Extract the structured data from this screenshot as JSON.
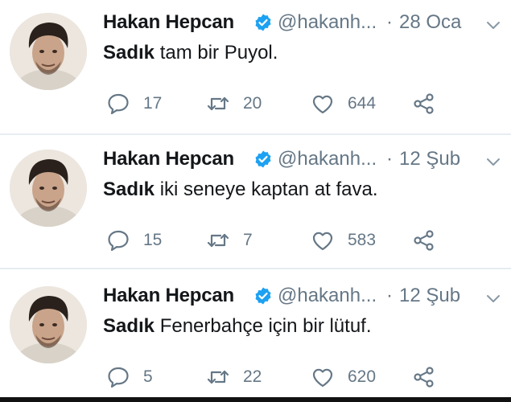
{
  "tweets": [
    {
      "author_name": "Hakan Hepcan",
      "handle": "@hakanh...",
      "separator": "·",
      "date": "28 Oca",
      "text_bold": "Sadık",
      "text_rest": " tam bir Puyol.",
      "replies": "17",
      "retweets": "20",
      "likes": "644"
    },
    {
      "author_name": "Hakan Hepcan",
      "handle": "@hakanh...",
      "separator": "·",
      "date": "12 Şub",
      "text_bold": "Sadık",
      "text_rest": " iki seneye kaptan at fava.",
      "replies": "15",
      "retweets": "7",
      "likes": "583"
    },
    {
      "author_name": "Hakan Hepcan",
      "handle": "@hakanh...",
      "separator": "·",
      "date": "12 Şub",
      "text_bold": "Sadık",
      "text_rest": " Fenerbahçe için bir lütuf.",
      "replies": "5",
      "retweets": "22",
      "likes": "620"
    }
  ],
  "icons": {
    "verified": "verified-badge-icon",
    "caret": "chevron-down-icon",
    "reply": "reply-icon",
    "retweet": "retweet-icon",
    "like": "heart-icon",
    "share": "share-icon"
  },
  "colors": {
    "accent": "#1da1f2",
    "secondary_text": "#657786",
    "primary_text": "#14171a",
    "divider": "#e6ecf0"
  }
}
